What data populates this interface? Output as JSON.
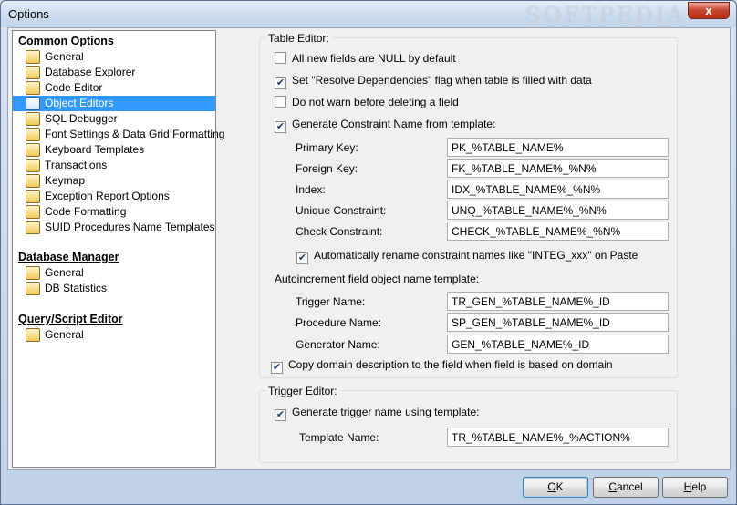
{
  "window": {
    "title": "Options",
    "watermark": "SOFTPEDIA",
    "close_glyph": "x"
  },
  "tree": {
    "sections": [
      {
        "heading": "Common Options",
        "items": [
          {
            "label": "General",
            "icon": "general-icon"
          },
          {
            "label": "Database Explorer",
            "icon": "database-explorer-icon"
          },
          {
            "label": "Code Editor",
            "icon": "code-editor-icon"
          },
          {
            "label": "Object Editors",
            "icon": "object-editors-icon",
            "selected": true
          },
          {
            "label": "SQL Debugger",
            "icon": "bug-icon"
          },
          {
            "label": "Font Settings & Data Grid Formatting",
            "icon": "font-icon"
          },
          {
            "label": "Keyboard Templates",
            "icon": "keyboard-icon"
          },
          {
            "label": "Transactions",
            "icon": "transactions-icon"
          },
          {
            "label": "Keymap",
            "icon": "keymap-icon"
          },
          {
            "label": "Exception Report Options",
            "icon": "exception-icon"
          },
          {
            "label": "Code Formatting",
            "icon": "code-formatting-icon"
          },
          {
            "label": "SUID Procedures Name Templates",
            "icon": "suid-icon"
          }
        ]
      },
      {
        "heading": "Database Manager",
        "items": [
          {
            "label": "General",
            "icon": "general-icon"
          },
          {
            "label": "DB Statistics",
            "icon": "statistics-icon"
          }
        ]
      },
      {
        "heading": "Query/Script Editor",
        "items": [
          {
            "label": "General",
            "icon": "general-icon"
          }
        ]
      }
    ]
  },
  "table_editor": {
    "label": "Table Editor:",
    "checks": [
      {
        "label": "All new fields are NULL by default",
        "checked": false
      },
      {
        "label": "Set \"Resolve Dependencies\" flag when table is filled with data",
        "checked": true
      },
      {
        "label": "Do not warn before deleting a field",
        "checked": false
      },
      {
        "label": "Generate Constraint Name from template:",
        "checked": true
      }
    ],
    "constraints": [
      {
        "label": "Primary Key:",
        "value": "PK_%TABLE_NAME%"
      },
      {
        "label": "Foreign Key:",
        "value": "FK_%TABLE_NAME%_%N%"
      },
      {
        "label": "Index:",
        "value": "IDX_%TABLE_NAME%_%N%"
      },
      {
        "label": "Unique Constraint:",
        "value": "UNQ_%TABLE_NAME%_%N%"
      },
      {
        "label": "Check Constraint:",
        "value": "CHECK_%TABLE_NAME%_%N%"
      }
    ],
    "auto_rename": {
      "label": "Automatically rename constraint names like \"INTEG_xxx\" on Paste",
      "checked": true
    },
    "autoinc_heading": "Autoincrement field object name template:",
    "autoinc": [
      {
        "label": "Trigger Name:",
        "value": "TR_GEN_%TABLE_NAME%_ID"
      },
      {
        "label": "Procedure Name:",
        "value": "SP_GEN_%TABLE_NAME%_ID"
      },
      {
        "label": "Generator Name:",
        "value": "GEN_%TABLE_NAME%_ID"
      }
    ],
    "copy_domain": {
      "label": "Copy domain description to the field when field is based on domain",
      "checked": true
    }
  },
  "trigger_editor": {
    "label": "Trigger Editor:",
    "generate": {
      "label": "Generate trigger name using template:",
      "checked": true
    },
    "template_label": "Template Name:",
    "template_value": "TR_%TABLE_NAME%_%ACTION%"
  },
  "buttons": {
    "ok": {
      "pre": "",
      "u": "O",
      "post": "K"
    },
    "cancel": {
      "pre": "",
      "u": "C",
      "post": "ancel"
    },
    "help": {
      "pre": "",
      "u": "H",
      "post": "elp"
    }
  }
}
